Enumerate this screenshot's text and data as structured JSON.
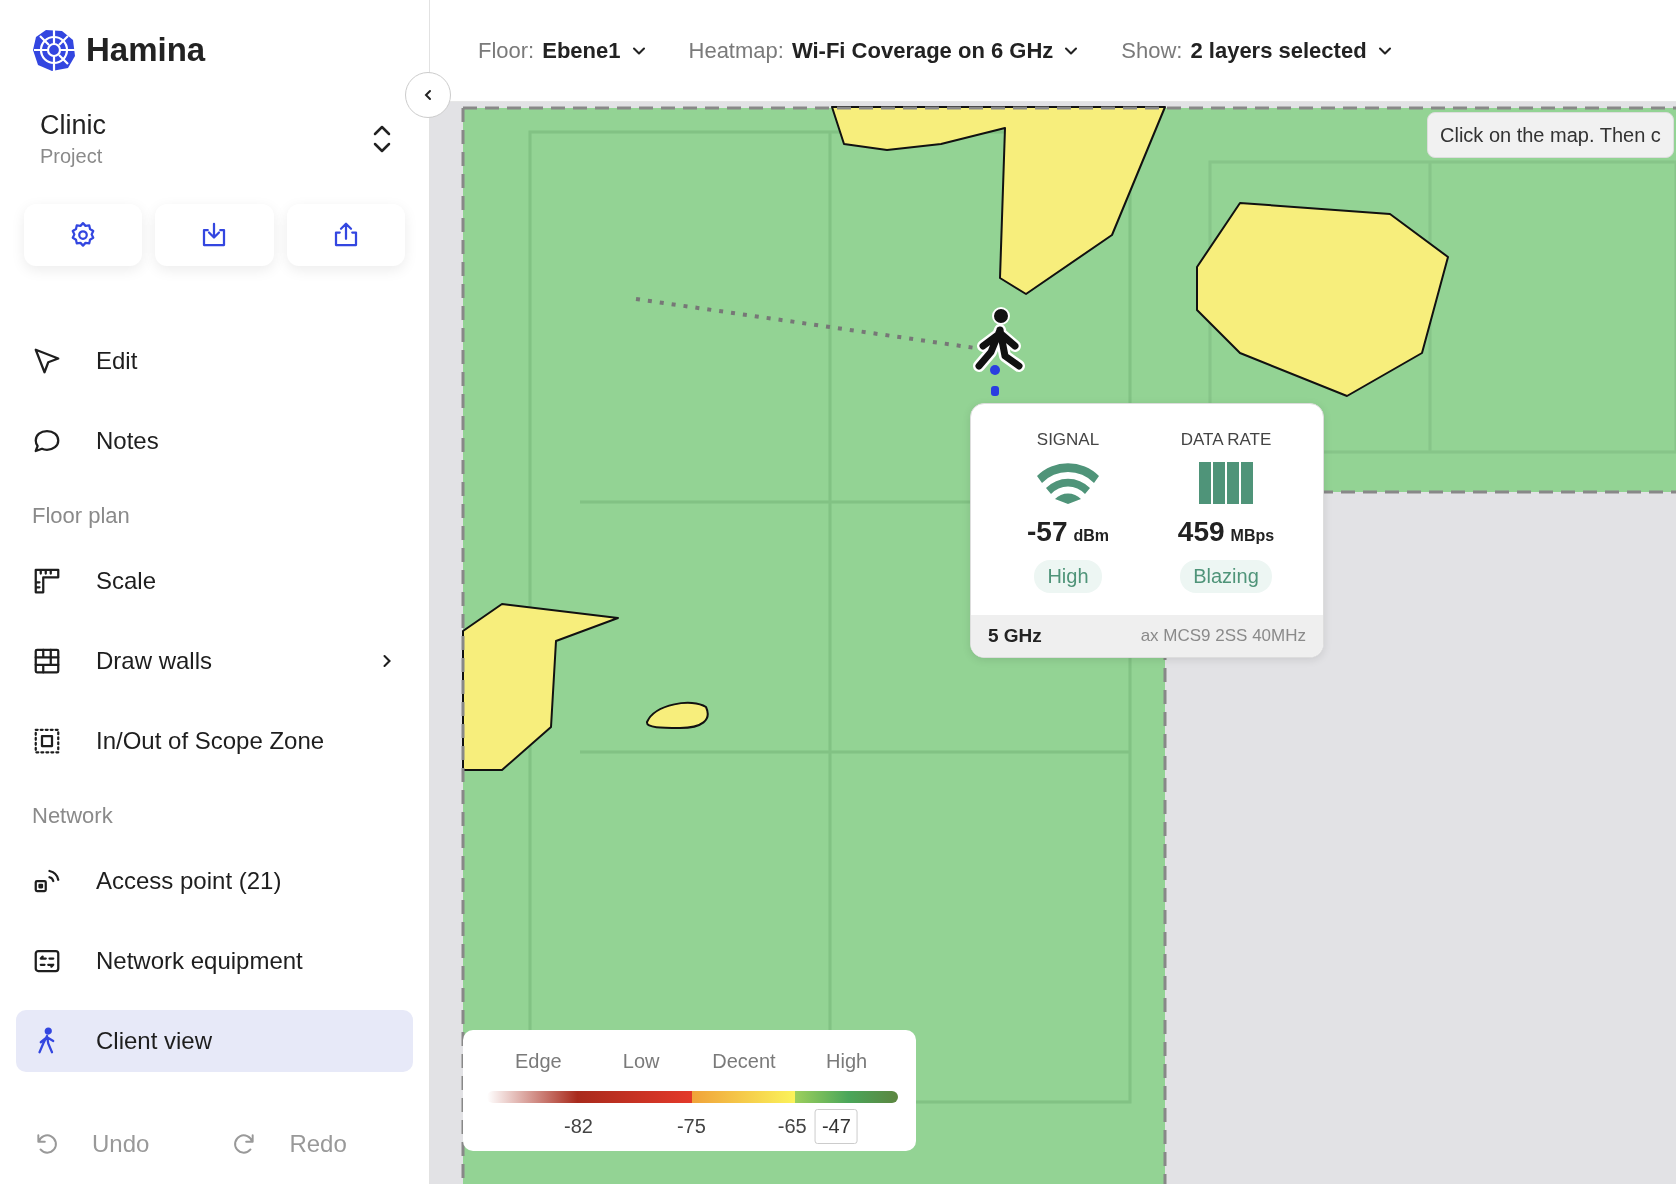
{
  "brand": {
    "name": "Hamina"
  },
  "project": {
    "name": "Clinic",
    "label": "Project"
  },
  "project_actions": [
    {
      "kind": "settings"
    },
    {
      "kind": "download"
    },
    {
      "kind": "share"
    }
  ],
  "nav": [
    {
      "kind": "edit",
      "label": "Edit",
      "selected": false,
      "submenu": false
    },
    {
      "kind": "notes",
      "label": "Notes",
      "selected": false,
      "submenu": false
    },
    {
      "kind": "heading",
      "label": "Floor plan"
    },
    {
      "kind": "scale",
      "label": "Scale",
      "selected": false,
      "submenu": false
    },
    {
      "kind": "walls",
      "label": "Draw walls",
      "selected": false,
      "submenu": true
    },
    {
      "kind": "scope",
      "label": "In/Out of Scope Zone",
      "selected": false,
      "submenu": false
    },
    {
      "kind": "heading",
      "label": "Network"
    },
    {
      "kind": "access_point",
      "label": "Access point (21)",
      "selected": false,
      "submenu": false
    },
    {
      "kind": "equipment",
      "label": "Network equipment",
      "selected": false,
      "submenu": false
    },
    {
      "kind": "client",
      "label": "Client view",
      "selected": true,
      "submenu": false
    }
  ],
  "history": [
    {
      "kind": "undo",
      "label": "Undo",
      "disabled": true
    },
    {
      "kind": "redo",
      "label": "Redo",
      "disabled": true
    }
  ],
  "toolbar": {
    "filters": [
      {
        "label": "Floor:",
        "value": "Ebene1"
      },
      {
        "label": "Heatmap:",
        "value": "Wi-Fi Coverage on 6 GHz"
      },
      {
        "label": "Show:",
        "value": "2 layers selected"
      }
    ]
  },
  "map": {
    "hint": "Click on the map. Then c",
    "info_card": {
      "metrics": [
        {
          "kind": "signal",
          "title": "SIGNAL",
          "value": "-57",
          "unit": "dBm",
          "rating": "High"
        },
        {
          "kind": "data_rate",
          "title": "DATA RATE",
          "value": "459",
          "unit": "MBps",
          "rating": "Blazing"
        }
      ],
      "band": "5 GHz",
      "details": "ax MCS9 2SS 40MHz"
    },
    "legend": {
      "bands": [
        "Edge",
        "Low",
        "Decent",
        "High"
      ],
      "thresholds": [
        "-82",
        "-75",
        "-65"
      ],
      "marker": {
        "value": "-47",
        "level": 0.85
      }
    }
  }
}
